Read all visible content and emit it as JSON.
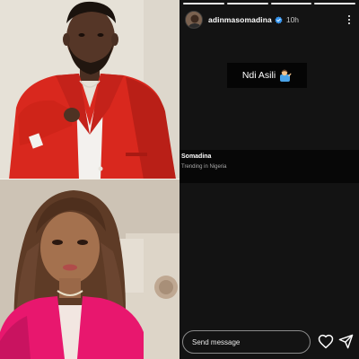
{
  "story": {
    "username": "adinmasomadina",
    "time_ago": "10h",
    "progress": {
      "segments": 4,
      "active_index": 3
    },
    "caption": {
      "text": "Ndi Asili",
      "emoji": "person-tipping-hand-emoji"
    },
    "shared_card": {
      "title": "Somadina",
      "subtitle": "Trending in Nigeria"
    },
    "reply": {
      "placeholder": "Send message"
    },
    "icons": {
      "verified": "verified-badge-icon",
      "more": "more-options-icon",
      "like": "heart-icon",
      "share": "send-icon"
    }
  },
  "colors": {
    "panel_bg": "#131313",
    "card_bg": "#070707",
    "verified_blue": "#3897f0",
    "suit_red": "#d9281e",
    "blazer_pink": "#e8176e"
  }
}
